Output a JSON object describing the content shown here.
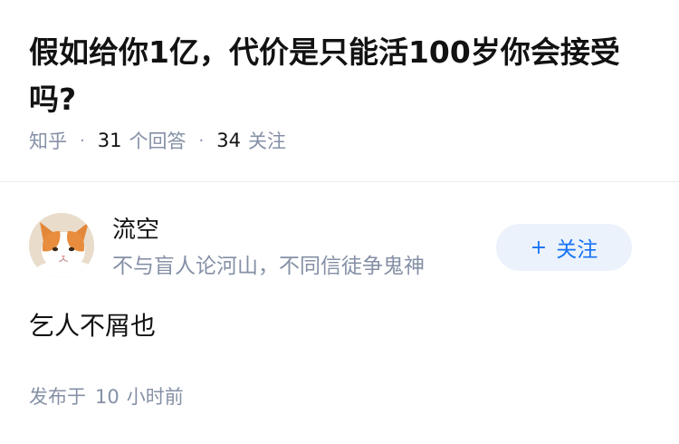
{
  "question": {
    "title": "假如给你1亿，代价是只能活100岁你会接受吗?",
    "source": "知乎",
    "answer_count": "31",
    "answer_label": "个回答",
    "follower_count": "34",
    "follower_label": "关注",
    "separator": "·"
  },
  "answer": {
    "author": {
      "name": "流空",
      "bio": "不与盲人论河山，不同信徒争鬼神",
      "avatar_icon": "cat-avatar-icon"
    },
    "follow_button": {
      "plus": "+",
      "label": "关注"
    },
    "content": "乞人不屑也",
    "published_prefix": "发布于",
    "published_value": "10",
    "published_unit": "小时前"
  },
  "colors": {
    "text": "#121212",
    "meta": "#8590a6",
    "accent": "#1772f6",
    "follow_bg": "#ebf2fb",
    "divider": "#ebebeb"
  }
}
